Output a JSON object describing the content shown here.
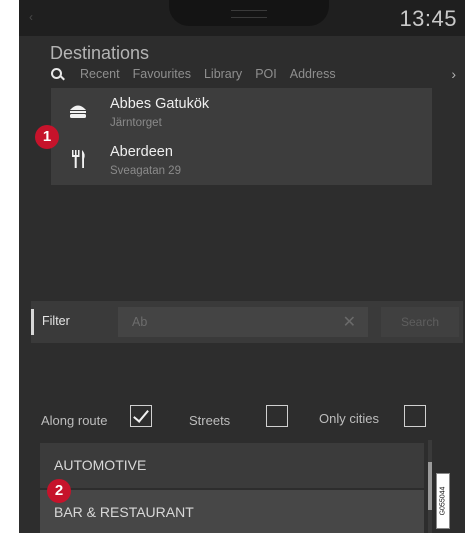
{
  "status_bar": {
    "time": "13:45"
  },
  "header": {
    "title": "Destinations",
    "search_icon": "search-icon",
    "tabs": [
      "Recent",
      "Favourites",
      "Library",
      "POI",
      "Address"
    ],
    "more_icon": "chevron-right-icon"
  },
  "results": [
    {
      "name": "Abbes Gatukök",
      "sub": "Järntorget",
      "icon": "burger-icon"
    },
    {
      "name": "Aberdeen",
      "sub": "Sveagatan 29",
      "icon": "fork-knife-icon"
    }
  ],
  "callouts": [
    "1",
    "2"
  ],
  "filter": {
    "label": "Filter",
    "value": "Ab",
    "clear_icon": "close-icon",
    "search_label": "Search"
  },
  "options": {
    "along_route": {
      "label": "Along route",
      "checked": true
    },
    "streets": {
      "label": "Streets",
      "checked": false
    },
    "only_cities": {
      "label": "Only cities",
      "checked": false
    }
  },
  "categories": [
    "AUTOMOTIVE",
    "BAR & RESTAURANT"
  ],
  "figure_id": "G055044",
  "colors": {
    "screen_bg": "#2d2d2d",
    "panel_bg": "#3d3d3d",
    "callout": "#c6132b"
  }
}
